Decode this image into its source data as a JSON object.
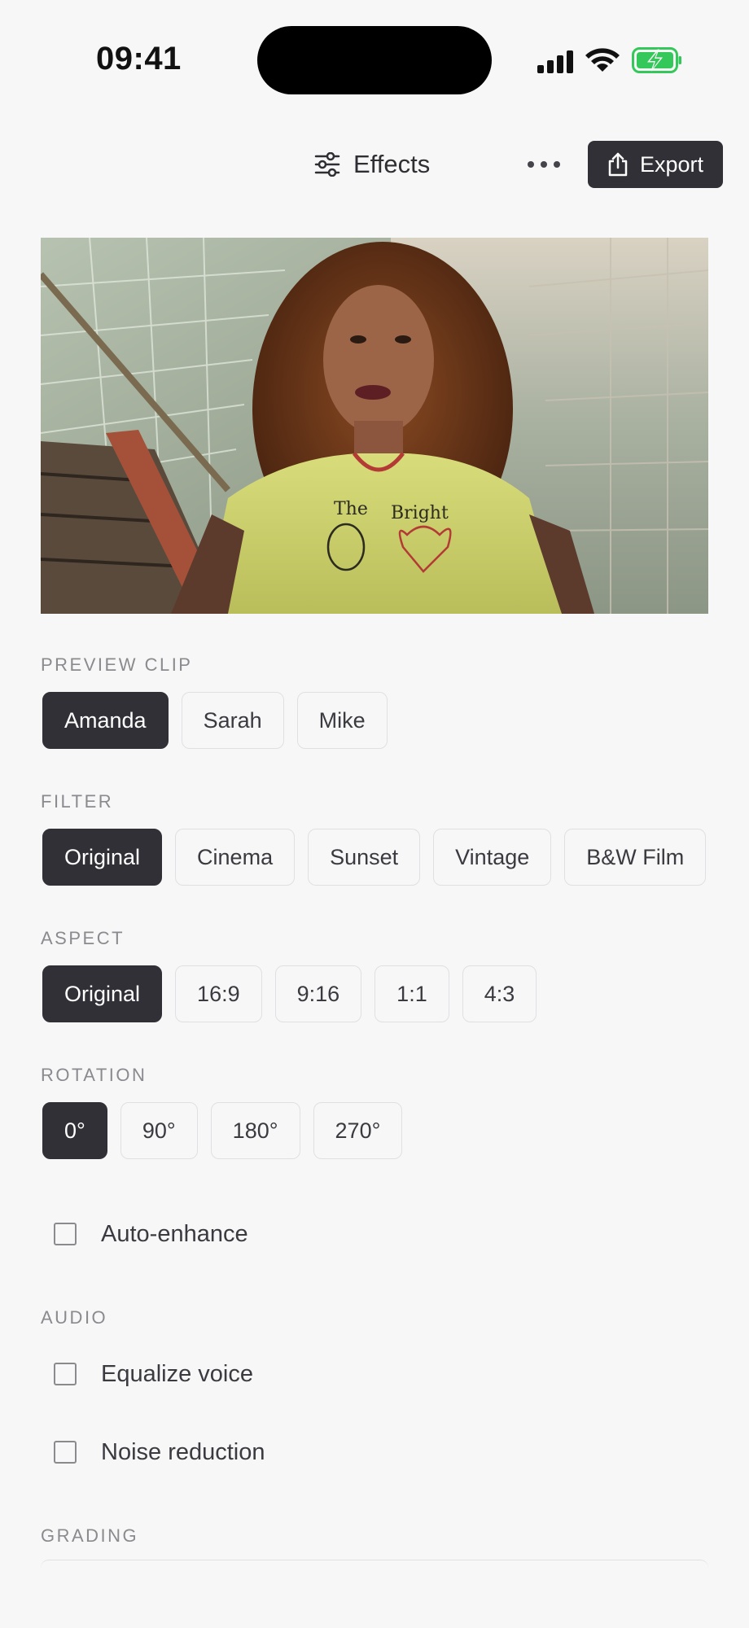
{
  "status_bar": {
    "time": "09:41"
  },
  "header": {
    "effects_label": "Effects",
    "export_label": "Export"
  },
  "preview": {
    "alt": "Video preview frame"
  },
  "sections": {
    "preview_clip": {
      "label": "PREVIEW CLIP",
      "options": [
        "Amanda",
        "Sarah",
        "Mike"
      ],
      "selected": "Amanda"
    },
    "filter": {
      "label": "FILTER",
      "options": [
        "Original",
        "Cinema",
        "Sunset",
        "Vintage",
        "B&W Film"
      ],
      "selected": "Original"
    },
    "aspect": {
      "label": "ASPECT",
      "options": [
        "Original",
        "16:9",
        "9:16",
        "1:1",
        "4:3"
      ],
      "selected": "Original"
    },
    "rotation": {
      "label": "ROTATION",
      "options": [
        "0°",
        "90°",
        "180°",
        "270°"
      ],
      "selected": "0°"
    },
    "auto_enhance": {
      "label": "Auto-enhance",
      "checked": false
    },
    "audio": {
      "label": "AUDIO",
      "equalize_voice": {
        "label": "Equalize voice",
        "checked": false
      },
      "noise_reduction": {
        "label": "Noise reduction",
        "checked": false
      }
    },
    "grading": {
      "label": "GRADING"
    }
  },
  "colors": {
    "accent_dark": "#303036",
    "background": "#f7f7f7",
    "battery_green": "#34c759"
  },
  "icons": [
    "sliders-icon",
    "more-icon",
    "share-icon",
    "signal-icon",
    "wifi-icon",
    "battery-icon"
  ]
}
